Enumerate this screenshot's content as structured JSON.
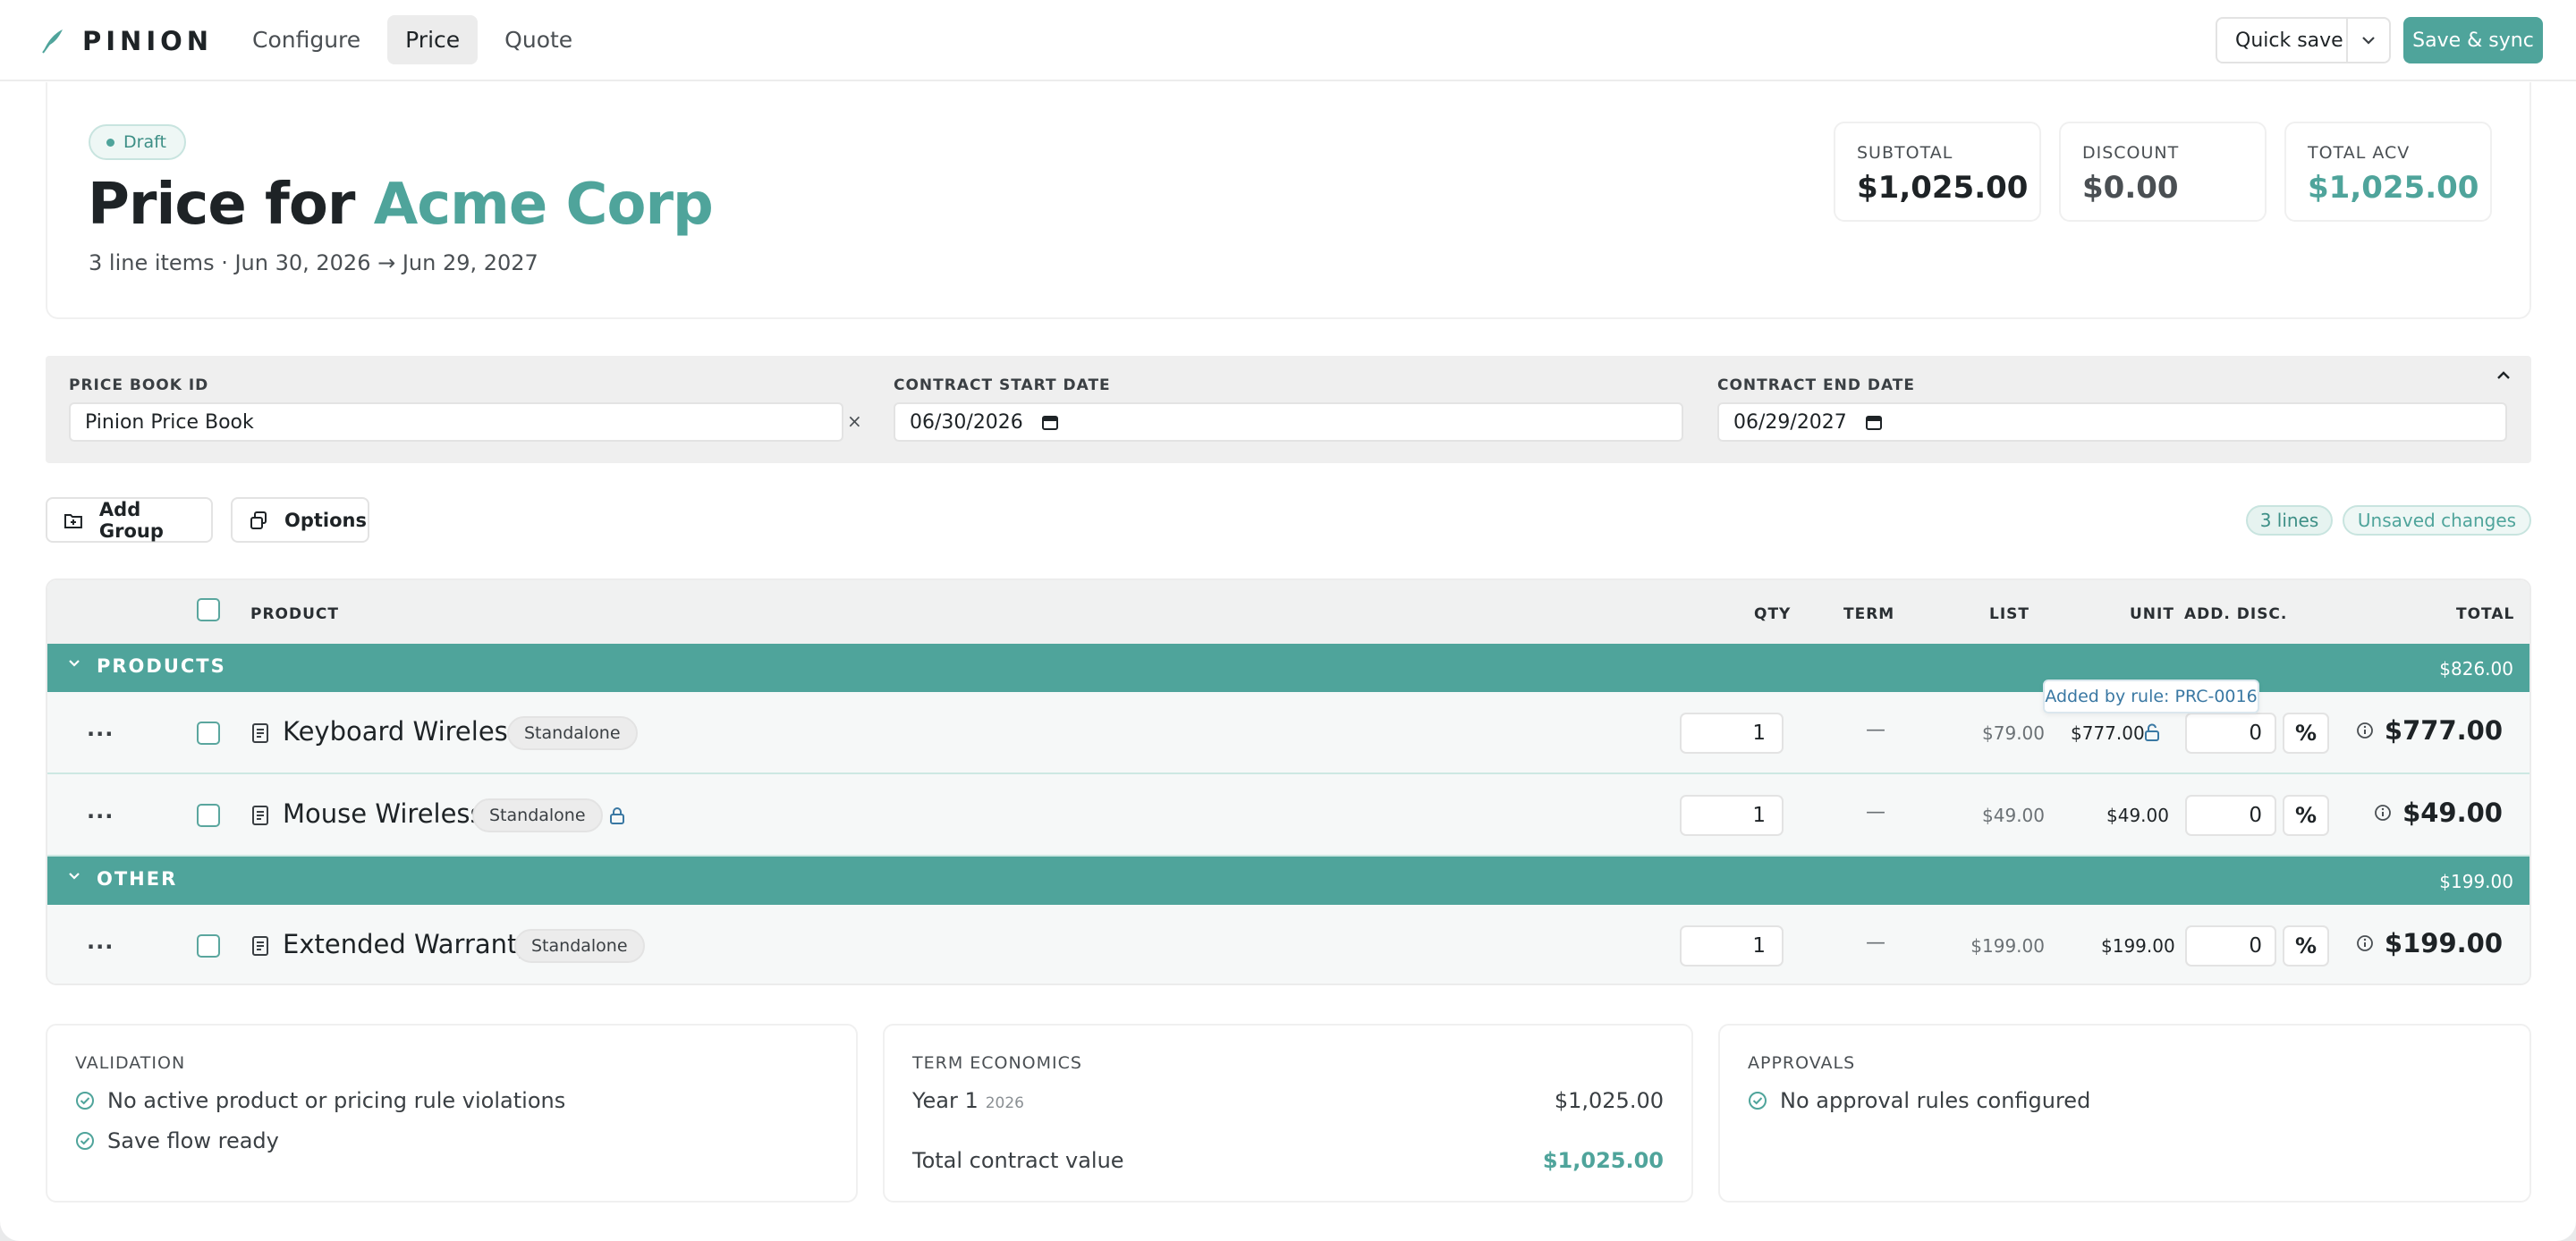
{
  "app": {
    "name": "PINION",
    "nav": [
      "Configure",
      "Price",
      "Quote"
    ],
    "active_tab": "Price",
    "quick_save_label": "Quick save",
    "save_sync_label": "Save & sync"
  },
  "header": {
    "status": "Draft",
    "title_prefix": "Price for ",
    "account": "Acme Corp",
    "subtitle": "3 line items · Jun 30, 2026 → Jun 29, 2027",
    "stats": [
      {
        "label": "SUBTOTAL",
        "value": "$1,025.00"
      },
      {
        "label": "DISCOUNT",
        "value": "$0.00"
      },
      {
        "label": "TOTAL ACV",
        "value": "$1,025.00"
      }
    ]
  },
  "fields": {
    "price_book_label": "PRICE BOOK ID",
    "price_book_value": "Pinion Price Book",
    "clear_symbol": "×",
    "start_label": "CONTRACT START DATE",
    "start_value": "06/30/2026",
    "end_label": "CONTRACT END DATE",
    "end_value": "06/29/2027"
  },
  "toolbar": {
    "add_group": "Add Group",
    "options": "Options",
    "lines_chip": "3 lines",
    "unsaved_chip": "Unsaved changes"
  },
  "table": {
    "headers": {
      "product": "PRODUCT",
      "qty": "QTY",
      "term": "TERM",
      "list": "LIST",
      "unit": "UNIT",
      "disc": "ADD. DISC.",
      "total": "TOTAL"
    },
    "groups": [
      {
        "name": "PRODUCTS",
        "total": "$826.00"
      },
      {
        "name": "OTHER",
        "total": "$199.00"
      }
    ],
    "rows": [
      {
        "product": "Keyboard Wireless",
        "badge": "Standalone",
        "qty": "1",
        "term": "—",
        "list": "$79.00",
        "unit": "$777.00",
        "disc": "0",
        "disc_unit": "%",
        "total": "$777.00"
      },
      {
        "product": "Mouse Wireless",
        "badge": "Standalone",
        "qty": "1",
        "term": "—",
        "list": "$49.00",
        "unit": "$49.00",
        "disc": "0",
        "disc_unit": "%",
        "total": "$49.00"
      },
      {
        "product": "Extended Warranty",
        "badge": "Standalone",
        "qty": "1",
        "term": "—",
        "list": "$199.00",
        "unit": "$199.00",
        "disc": "0",
        "disc_unit": "%",
        "total": "$199.00"
      }
    ],
    "tooltip": "Added by rule: PRC-0016",
    "more_symbol": "···"
  },
  "validation": {
    "title": "VALIDATION",
    "items": [
      "No active product or pricing rule violations",
      "Save flow ready"
    ]
  },
  "term_economics": {
    "title": "TERM ECONOMICS",
    "year_label": "Year 1",
    "year_value": "2026",
    "year_amount": "$1,025.00",
    "tcv_label": "Total contract value",
    "tcv_amount": "$1,025.00"
  },
  "approvals": {
    "title": "APPROVALS",
    "items": [
      "No approval rules configured"
    ]
  },
  "colors": {
    "accent": "#4fa49b",
    "link": "#3a78a3"
  }
}
